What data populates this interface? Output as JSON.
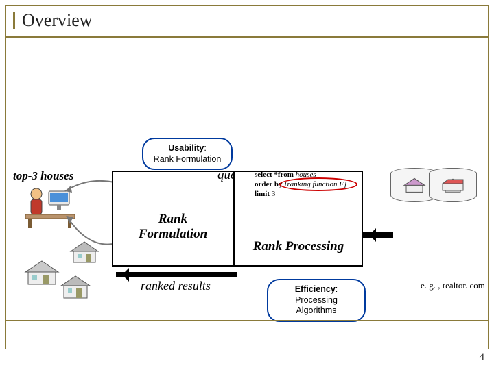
{
  "title": "Overview",
  "bubble1": {
    "strong": "Usability",
    "rest": ":\nRank Formulation"
  },
  "leftLabel": "top-3 houses",
  "queryLabel": "query",
  "sql": {
    "line1_kw": "select *from",
    "line1_em": " houses",
    "line2_kw": "order by",
    "line2_em": " [ranking function F]",
    "line3_kw": "limit",
    "line3_rest": " 3"
  },
  "rankFormulation": "Rank\nFormulation",
  "rankProcessing": "Rank Processing",
  "rankedResults": "ranked results",
  "bubble2": {
    "strong": "Efficiency",
    "rest": ":\nProcessing Algorithms"
  },
  "caption": "e. g. , realtor. com",
  "pageNum": "4"
}
